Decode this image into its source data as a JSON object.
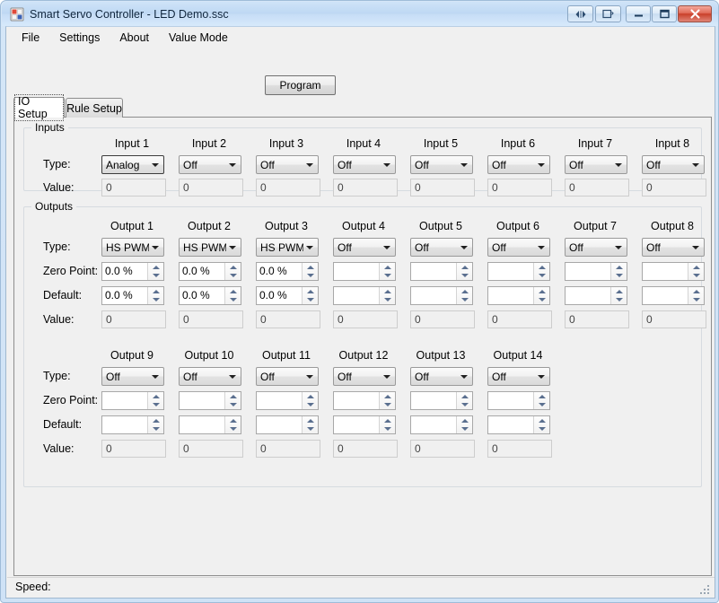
{
  "window": {
    "title": "Smart Servo Controller - LED Demo.ssc",
    "app_icon": "app-grid-icon",
    "controls": {
      "extra1_icon": "navigate-icon",
      "extra2_icon": "restore-window-icon",
      "minimize_label": "—",
      "maximize_label": "□",
      "close_label": "✕"
    }
  },
  "menu": {
    "items": [
      {
        "label": "File"
      },
      {
        "label": "Settings"
      },
      {
        "label": "About"
      },
      {
        "label": "Value Mode"
      }
    ]
  },
  "toolbar": {
    "program_label": "Program"
  },
  "tabs": [
    {
      "label": "IO Setup",
      "active": true
    },
    {
      "label": "Rule Setup",
      "active": false
    }
  ],
  "inputs_group": {
    "title": "Inputs",
    "row_labels": {
      "type": "Type:",
      "value": "Value:"
    },
    "columns": [
      {
        "header": "Input 1",
        "type": "Analog",
        "type_focused": true,
        "value": "0"
      },
      {
        "header": "Input 2",
        "type": "Off",
        "type_focused": false,
        "value": "0"
      },
      {
        "header": "Input 3",
        "type": "Off",
        "type_focused": false,
        "value": "0"
      },
      {
        "header": "Input 4",
        "type": "Off",
        "type_focused": false,
        "value": "0"
      },
      {
        "header": "Input 5",
        "type": "Off",
        "type_focused": false,
        "value": "0"
      },
      {
        "header": "Input 6",
        "type": "Off",
        "type_focused": false,
        "value": "0"
      },
      {
        "header": "Input 7",
        "type": "Off",
        "type_focused": false,
        "value": "0"
      },
      {
        "header": "Input 8",
        "type": "Off",
        "type_focused": false,
        "value": "0"
      }
    ]
  },
  "outputs_group": {
    "title": "Outputs",
    "row_labels": {
      "type": "Type:",
      "zero_point": "Zero Point:",
      "default": "Default:",
      "value": "Value:"
    },
    "row1": [
      {
        "header": "Output 1",
        "type": "HS PWM",
        "zero_point": "0.0 %",
        "default": "0.0 %",
        "value": "0"
      },
      {
        "header": "Output 2",
        "type": "HS PWM",
        "zero_point": "0.0 %",
        "default": "0.0 %",
        "value": "0"
      },
      {
        "header": "Output 3",
        "type": "HS PWM",
        "zero_point": "0.0 %",
        "default": "0.0 %",
        "value": "0"
      },
      {
        "header": "Output 4",
        "type": "Off",
        "zero_point": "",
        "default": "",
        "value": "0"
      },
      {
        "header": "Output 5",
        "type": "Off",
        "zero_point": "",
        "default": "",
        "value": "0"
      },
      {
        "header": "Output 6",
        "type": "Off",
        "zero_point": "",
        "default": "",
        "value": "0"
      },
      {
        "header": "Output 7",
        "type": "Off",
        "zero_point": "",
        "default": "",
        "value": "0"
      },
      {
        "header": "Output 8",
        "type": "Off",
        "zero_point": "",
        "default": "",
        "value": "0"
      }
    ],
    "row2": [
      {
        "header": "Output 9",
        "type": "Off",
        "zero_point": "",
        "default": "",
        "value": "0"
      },
      {
        "header": "Output 10",
        "type": "Off",
        "zero_point": "",
        "default": "",
        "value": "0"
      },
      {
        "header": "Output 11",
        "type": "Off",
        "zero_point": "",
        "default": "",
        "value": "0"
      },
      {
        "header": "Output 12",
        "type": "Off",
        "zero_point": "",
        "default": "",
        "value": "0"
      },
      {
        "header": "Output 13",
        "type": "Off",
        "zero_point": "",
        "default": "",
        "value": "0"
      },
      {
        "header": "Output 14",
        "type": "Off",
        "zero_point": "",
        "default": "",
        "value": "0"
      }
    ]
  },
  "statusbar": {
    "speed_label": "Speed:"
  }
}
